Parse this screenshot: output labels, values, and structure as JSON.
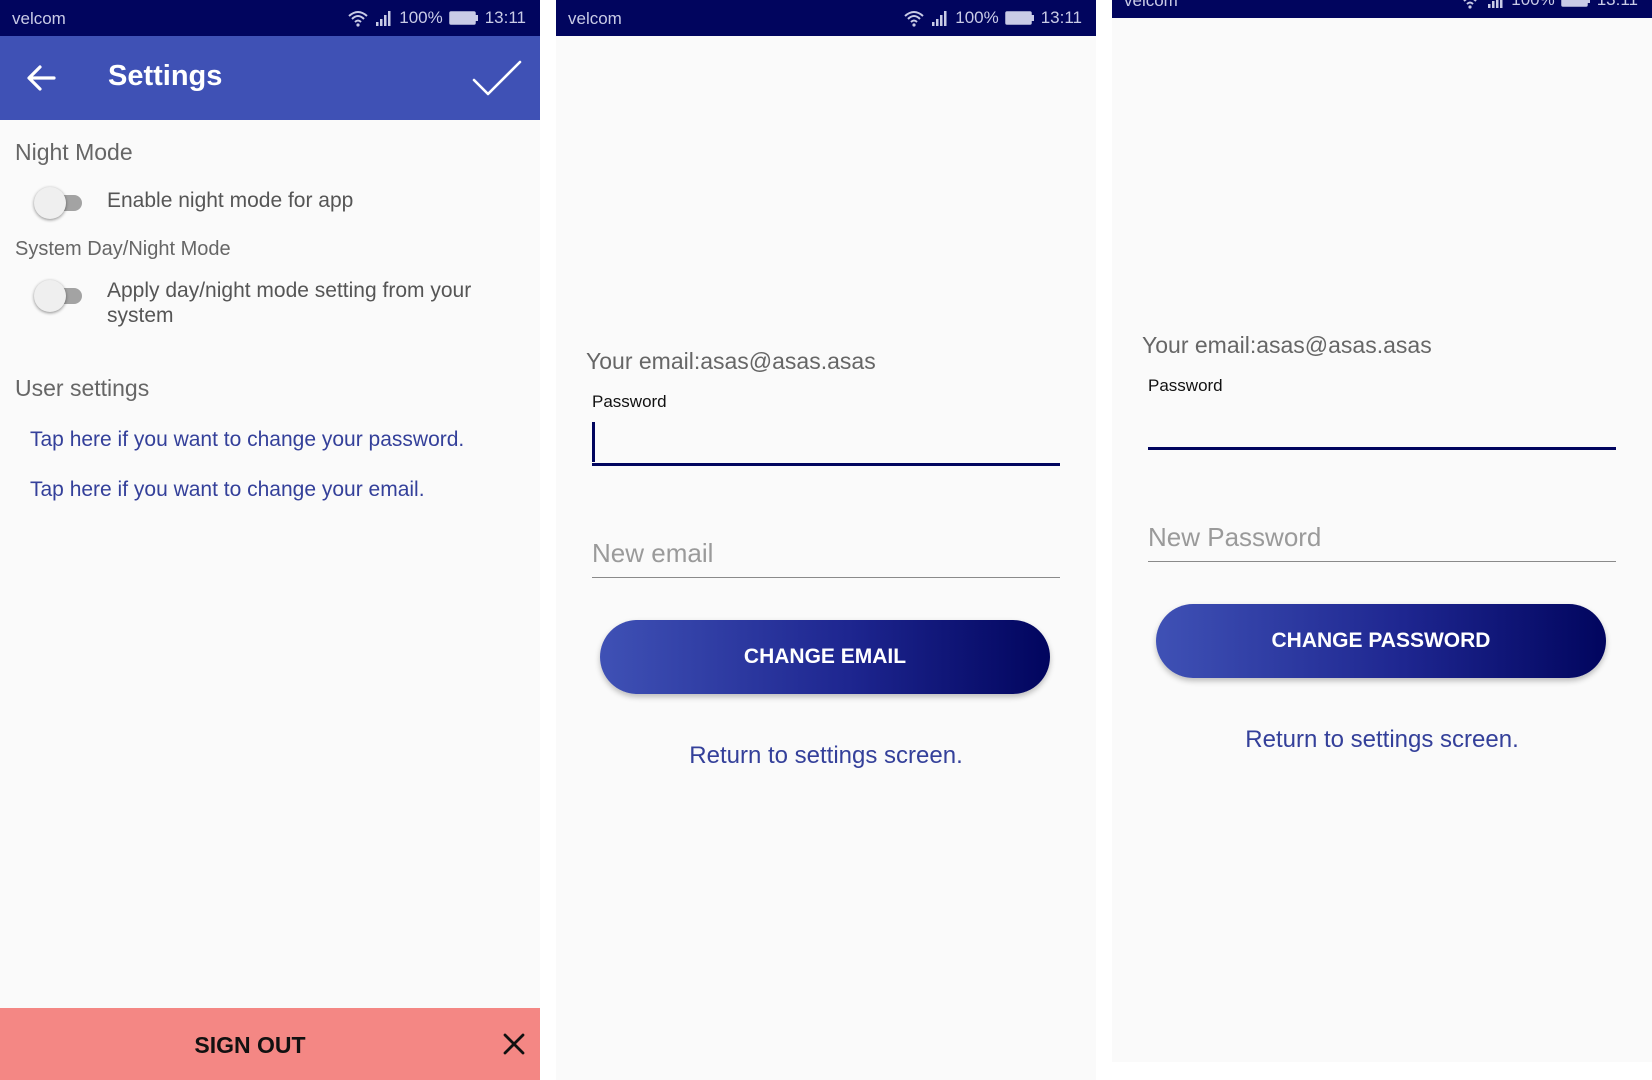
{
  "status_bar": {
    "carrier": "velcom",
    "signal_text": "100%",
    "time": "13:11",
    "icons": [
      "wifi-icon",
      "signal-icon",
      "battery-icon"
    ]
  },
  "settings_screen": {
    "title": "Settings",
    "night_mode": {
      "section_title": "Night Mode",
      "toggle_label": "Enable night mode for app",
      "enabled": false
    },
    "system_mode": {
      "section_title": "System Day/Night Mode",
      "toggle_label": "Apply day/night mode setting from your system",
      "enabled": false
    },
    "user_settings": {
      "section_title": "User settings",
      "change_password_link": "Tap here if you want to change your password.",
      "change_email_link": "Tap here if you want to change your email."
    },
    "sign_out_label": "SIGN OUT"
  },
  "change_email_screen": {
    "email_display": "Your email:asas@asas.asas",
    "password_label": "Password",
    "password_value": "",
    "new_email_placeholder": "New email",
    "button_label": "CHANGE EMAIL",
    "return_link": "Return to settings screen."
  },
  "change_password_screen": {
    "email_display": "Your email:asas@asas.asas",
    "password_label": "Password",
    "password_value": "",
    "new_password_placeholder": "New Password",
    "button_label": "CHANGE PASSWORD",
    "return_link": "Return to settings screen."
  },
  "colors": {
    "status_bar": "#01055e",
    "app_bar": "#3f51b5",
    "accent_dark": "#01055e",
    "link": "#34409a",
    "sign_out_bar": "#f48784",
    "background": "#fafafa"
  }
}
